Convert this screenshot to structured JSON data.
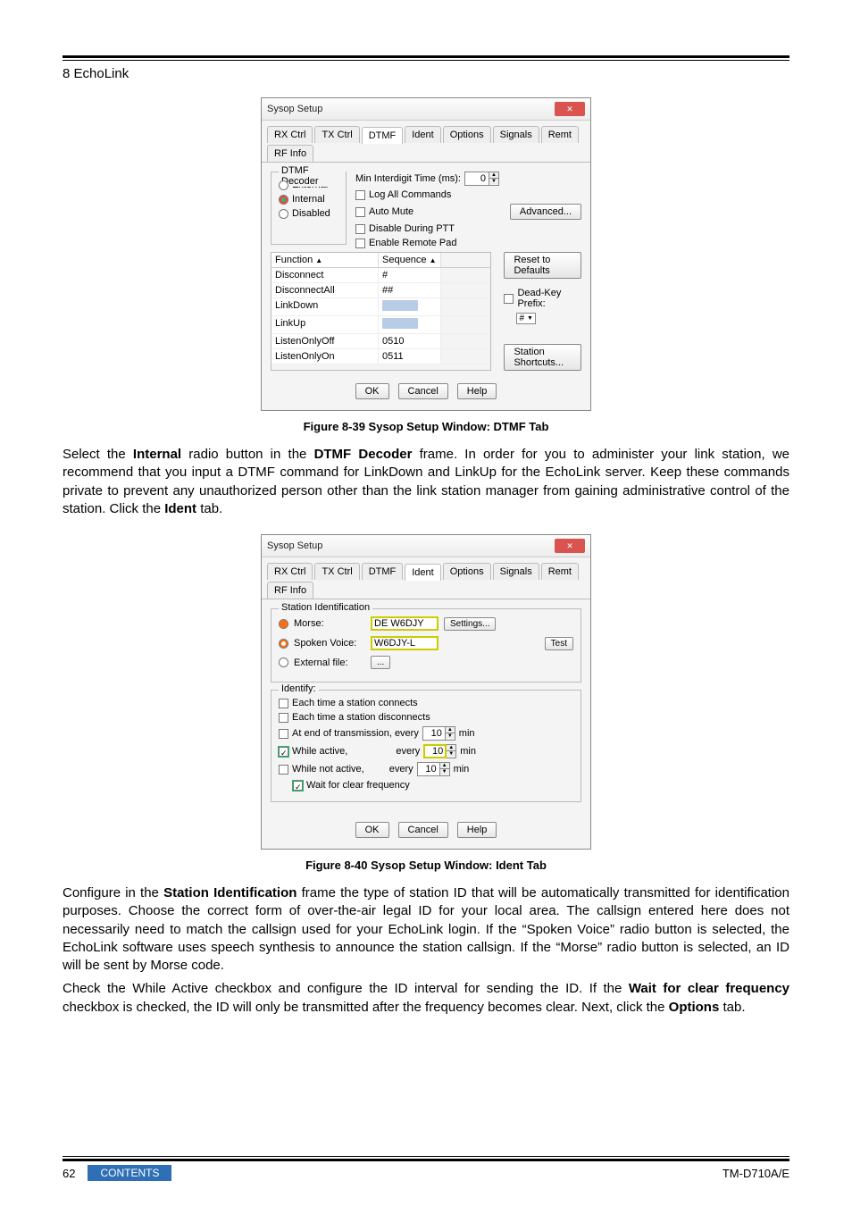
{
  "header": {
    "section": "8 EchoLink"
  },
  "dialog_title": "Sysop Setup",
  "tabs": [
    "RX Ctrl",
    "TX Ctrl",
    "DTMF",
    "Ident",
    "Options",
    "Signals",
    "Remt",
    "RF Info"
  ],
  "dtmf": {
    "frame_label": "DTMF Decoder",
    "radios": {
      "external": "External",
      "internal": "Internal",
      "disabled": "Disabled"
    },
    "min_label": "Min Interdigit Time (ms):",
    "min_value": "0",
    "log_all": "Log All Commands",
    "auto_mute": "Auto Mute",
    "advanced": "Advanced...",
    "disable_ptt": "Disable During PTT",
    "enable_pad": "Enable Remote Pad",
    "thead_func": "Function",
    "thead_seq": "Sequence",
    "rows": [
      {
        "f": "Disconnect",
        "s": "#"
      },
      {
        "f": "DisconnectAll",
        "s": "##"
      },
      {
        "f": "LinkDown",
        "s": ""
      },
      {
        "f": "LinkUp",
        "s": ""
      },
      {
        "f": "ListenOnlyOff",
        "s": "0510"
      },
      {
        "f": "ListenOnlyOn",
        "s": "0511"
      }
    ],
    "reset": "Reset to Defaults",
    "deadkey_label": "Dead-Key Prefix:",
    "deadkey_val": "#",
    "shortcuts": "Station Shortcuts..."
  },
  "fig_dtmf": "Figure 8-39   Sysop Setup Window: DTMF Tab",
  "para1_a": "Select the ",
  "para1_b": "Internal",
  "para1_c": " radio button in the ",
  "para1_d": "DTMF Decoder",
  "para1_e": " frame.  In order for you to administer your link station, we recommend that you input a DTMF command for LinkDown and LinkUp for the EchoLink server.  Keep these commands private to prevent any unauthorized person other than the link station manager from gaining administrative control of the station.  Click the ",
  "para1_f": "Ident",
  "para1_g": " tab.",
  "ident": {
    "frame_label": "Station Identification",
    "morse": "Morse:",
    "morse_val": "DE W6DJY",
    "settings": "Settings...",
    "spoken": "Spoken Voice:",
    "spoken_val": "W6DJY-L",
    "test": "Test",
    "extfile": "External file:",
    "extfile_btn": "...",
    "identify_label": "Identify:",
    "each_conn": "Each time a station connects",
    "each_disc": "Each time a station disconnects",
    "at_end": "At end of transmission, every",
    "while_active": "While active,",
    "while_not": "While not active,",
    "every": "every",
    "min": "min",
    "spin1": "10",
    "spin2": "10",
    "spin3": "10",
    "wait": "Wait for clear frequency"
  },
  "fig_ident": "Figure 8-40   Sysop Setup Window: Ident Tab",
  "para2_a": "Configure in the ",
  "para2_b": "Station Identification",
  "para2_c": " frame the type of station ID that will be automatically transmitted for identification purposes.  Choose the correct form of over-the-air legal ID for your local area.  The callsign entered here does not necessarily need to match the callsign used for your EchoLink login.  If the “Spoken Voice” radio button is selected, the EchoLink software uses speech synthesis to announce the station callsign.  If the “Morse” radio button is selected, an ID will be sent by Morse code.",
  "para3_a": "Check the While Active checkbox and configure the ID interval for sending the ID.  If the ",
  "para3_b": "Wait for clear frequency",
  "para3_c": " checkbox is checked, the ID will only be transmitted after the frequency becomes clear.  Next, click the ",
  "para3_d": "Options",
  "para3_e": " tab.",
  "buttons": {
    "ok": "OK",
    "cancel": "Cancel",
    "help": "Help"
  },
  "footer": {
    "page": "62",
    "contents": "CONTENTS",
    "model": "TM-D710A/E"
  }
}
